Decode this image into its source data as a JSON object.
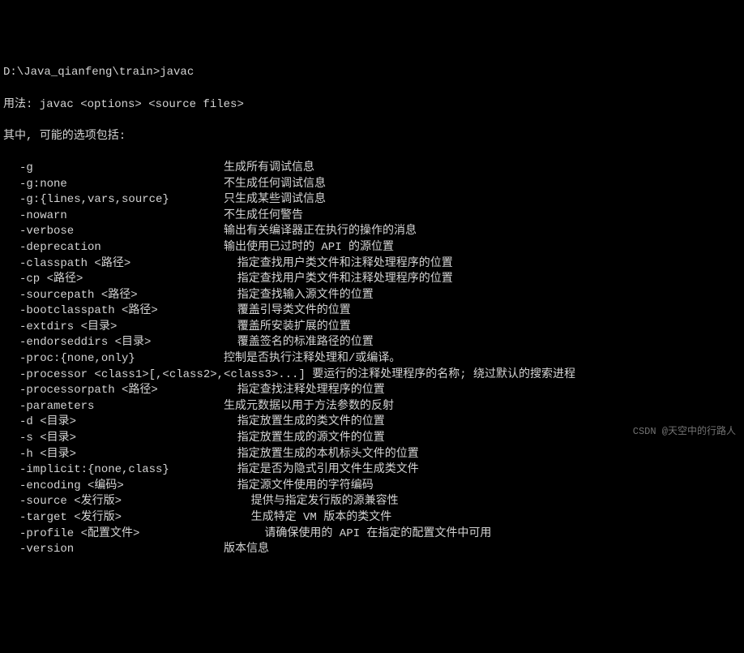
{
  "prompt": "D:\\Java_qianfeng\\train>javac",
  "usage": "用法: javac <options> <source files>",
  "subheader": "其中, 可能的选项包括:",
  "options": [
    {
      "key": "-g",
      "desc": "生成所有调试信息"
    },
    {
      "key": "-g:none",
      "desc": "不生成任何调试信息"
    },
    {
      "key": "-g:{lines,vars,source}",
      "desc": "只生成某些调试信息"
    },
    {
      "key": "-nowarn",
      "desc": "不生成任何警告"
    },
    {
      "key": "-verbose",
      "desc": "输出有关编译器正在执行的操作的消息"
    },
    {
      "key": "-deprecation",
      "desc": "输出使用已过时的 API 的源位置"
    },
    {
      "key": "-classpath <路径>",
      "desc": "  指定查找用户类文件和注释处理程序的位置"
    },
    {
      "key": "-cp <路径>",
      "desc": "  指定查找用户类文件和注释处理程序的位置"
    },
    {
      "key": "-sourcepath <路径>",
      "desc": "  指定查找输入源文件的位置"
    },
    {
      "key": "-bootclasspath <路径>",
      "desc": "  覆盖引导类文件的位置"
    },
    {
      "key": "-extdirs <目录>",
      "desc": "  覆盖所安装扩展的位置"
    },
    {
      "key": "-endorseddirs <目录>",
      "desc": "  覆盖签名的标准路径的位置"
    },
    {
      "key": "-proc:{none,only}",
      "desc": "控制是否执行注释处理和/或编译。"
    },
    {
      "key": "-processor <class1>[,<class2>,<class3>...] 要运行的注释处理程序的名称; 绕过默认的搜索进程",
      "desc": ""
    },
    {
      "key": "-processorpath <路径>",
      "desc": "  指定查找注释处理程序的位置"
    },
    {
      "key": "-parameters",
      "desc": "生成元数据以用于方法参数的反射"
    },
    {
      "key": "-d <目录>",
      "desc": "  指定放置生成的类文件的位置"
    },
    {
      "key": "-s <目录>",
      "desc": "  指定放置生成的源文件的位置"
    },
    {
      "key": "-h <目录>",
      "desc": "  指定放置生成的本机标头文件的位置"
    },
    {
      "key": "-implicit:{none,class}",
      "desc": "  指定是否为隐式引用文件生成类文件"
    },
    {
      "key": "-encoding <编码>",
      "desc": "  指定源文件使用的字符编码"
    },
    {
      "key": "-source <发行版>",
      "desc": "    提供与指定发行版的源兼容性"
    },
    {
      "key": "-target <发行版>",
      "desc": "    生成特定 VM 版本的类文件"
    },
    {
      "key": "-profile <配置文件>",
      "desc": "      请确保使用的 API 在指定的配置文件中可用"
    },
    {
      "key": "-version",
      "desc": "版本信息"
    }
  ],
  "watermark": "CSDN @天空中的行路人"
}
